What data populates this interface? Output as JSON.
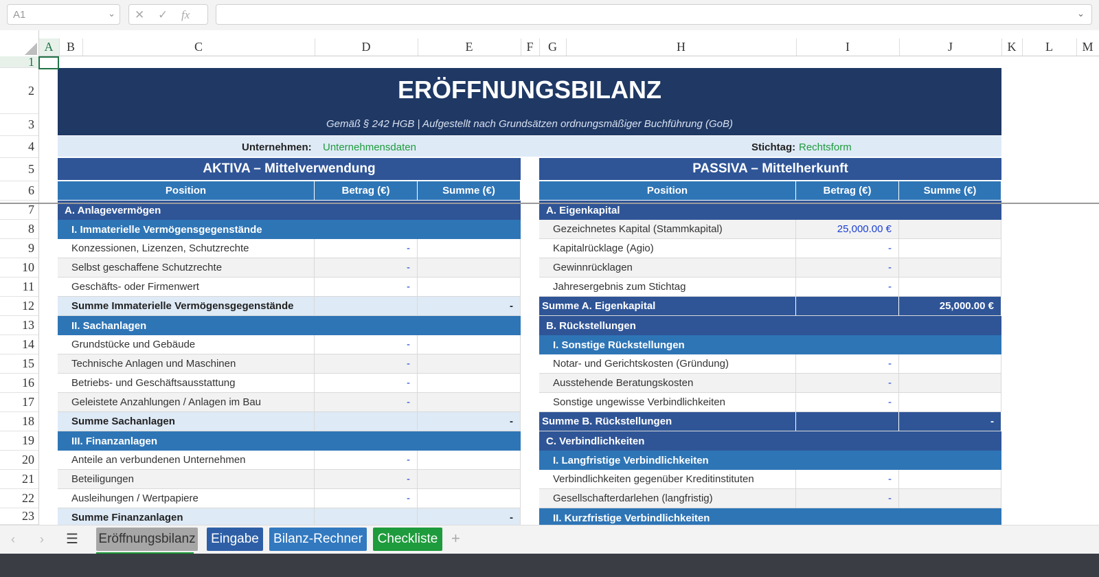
{
  "formula_bar": {
    "cell_ref": "A1",
    "cancel": "✕",
    "confirm": "✓",
    "fx": "fx",
    "formula": ""
  },
  "columns": [
    "A",
    "B",
    "C",
    "D",
    "E",
    "F",
    "G",
    "H",
    "I",
    "J",
    "K",
    "L",
    "M"
  ],
  "rows": [
    "1",
    "2",
    "3",
    "4",
    "5",
    "6",
    "7",
    "8",
    "9",
    "10",
    "11",
    "12",
    "13",
    "14",
    "15",
    "16",
    "17",
    "18",
    "19",
    "20",
    "21",
    "22",
    "23"
  ],
  "header": {
    "title": "ERÖFFNUNGSBILANZ",
    "subtitle": "Gemäß § 242 HGB  |  Aufgestellt nach Grundsätzen ordnungsmäßiger Buchführung (GoB)",
    "company_label": "Unternehmen:",
    "company_value": "Unternehmensdaten",
    "date_label": "Stichtag:",
    "date_value": "Rechtsform"
  },
  "aktiva": {
    "title": "AKTIVA  –  Mittelverwendung",
    "col_position": "Position",
    "col_betrag": "Betrag (€)",
    "col_summe": "Summe (€)",
    "rows": [
      {
        "type": "sec",
        "label": "A.  Anlagevermögen",
        "betrag": "",
        "summe": ""
      },
      {
        "type": "sub",
        "label": "I.  Immaterielle Vermögensgegenstände",
        "betrag": "",
        "summe": ""
      },
      {
        "type": "item",
        "label": "Konzessionen, Lizenzen, Schutzrechte",
        "betrag": "-",
        "summe": ""
      },
      {
        "type": "item alt",
        "label": "Selbst geschaffene Schutzrechte",
        "betrag": "-",
        "summe": ""
      },
      {
        "type": "item",
        "label": "Geschäfts- oder Firmenwert",
        "betrag": "-",
        "summe": ""
      },
      {
        "type": "sum",
        "label": "Summe Immaterielle Vermögensgegenstände",
        "betrag": "",
        "summe": "-"
      },
      {
        "type": "sub",
        "label": "II.  Sachanlagen",
        "betrag": "",
        "summe": ""
      },
      {
        "type": "item",
        "label": "Grundstücke und Gebäude",
        "betrag": "-",
        "summe": ""
      },
      {
        "type": "item alt",
        "label": "Technische Anlagen und Maschinen",
        "betrag": "-",
        "summe": ""
      },
      {
        "type": "item",
        "label": "Betriebs- und Geschäftsausstattung",
        "betrag": "-",
        "summe": ""
      },
      {
        "type": "item alt",
        "label": "Geleistete Anzahlungen / Anlagen im Bau",
        "betrag": "-",
        "summe": ""
      },
      {
        "type": "sum",
        "label": "Summe Sachanlagen",
        "betrag": "",
        "summe": "-"
      },
      {
        "type": "sub",
        "label": "III.  Finanzanlagen",
        "betrag": "",
        "summe": ""
      },
      {
        "type": "item",
        "label": "Anteile an verbundenen Unternehmen",
        "betrag": "-",
        "summe": ""
      },
      {
        "type": "item alt",
        "label": "Beteiligungen",
        "betrag": "-",
        "summe": ""
      },
      {
        "type": "item",
        "label": "Ausleihungen / Wertpapiere",
        "betrag": "-",
        "summe": ""
      },
      {
        "type": "sum",
        "label": "Summe Finanzanlagen",
        "betrag": "",
        "summe": "-"
      }
    ]
  },
  "passiva": {
    "title": "PASSIVA  –  Mittelherkunft",
    "col_position": "Position",
    "col_betrag": "Betrag (€)",
    "col_summe": "Summe (€)",
    "rows": [
      {
        "type": "sec",
        "label": "A.  Eigenkapital",
        "betrag": "",
        "summe": ""
      },
      {
        "type": "item alt",
        "label": "Gezeichnetes Kapital (Stammkapital)",
        "betrag": "25,000.00 €",
        "summe": ""
      },
      {
        "type": "item",
        "label": "Kapitalrücklage (Agio)",
        "betrag": "-",
        "summe": ""
      },
      {
        "type": "item alt",
        "label": "Gewinnrücklagen",
        "betrag": "-",
        "summe": ""
      },
      {
        "type": "item",
        "label": "Jahresergebnis zum Stichtag",
        "betrag": "-",
        "summe": ""
      },
      {
        "type": "sumd",
        "label": "Summe A.  Eigenkapital",
        "betrag": "",
        "summe": "25,000.00 €"
      },
      {
        "type": "sec",
        "label": "B.  Rückstellungen",
        "betrag": "",
        "summe": ""
      },
      {
        "type": "sub",
        "label": "I.  Sonstige Rückstellungen",
        "betrag": "",
        "summe": ""
      },
      {
        "type": "item",
        "label": "Notar- und Gerichtskosten (Gründung)",
        "betrag": "-",
        "summe": ""
      },
      {
        "type": "item alt",
        "label": "Ausstehende Beratungskosten",
        "betrag": "-",
        "summe": ""
      },
      {
        "type": "item",
        "label": "Sonstige ungewisse Verbindlichkeiten",
        "betrag": "-",
        "summe": ""
      },
      {
        "type": "sumd",
        "label": "Summe B.  Rückstellungen",
        "betrag": "",
        "summe": "-"
      },
      {
        "type": "sec",
        "label": "C.  Verbindlichkeiten",
        "betrag": "",
        "summe": ""
      },
      {
        "type": "sub",
        "label": "I.  Langfristige Verbindlichkeiten",
        "betrag": "",
        "summe": ""
      },
      {
        "type": "item",
        "label": "Verbindlichkeiten gegenüber Kreditinstituten",
        "betrag": "-",
        "summe": ""
      },
      {
        "type": "item alt",
        "label": "Gesellschafterdarlehen (langfristig)",
        "betrag": "-",
        "summe": ""
      },
      {
        "type": "sub",
        "label": "II.  Kurzfristige Verbindlichkeiten",
        "betrag": "",
        "summe": ""
      }
    ]
  },
  "tabs": [
    {
      "label": "Eröffnungsbilanz",
      "style": "active"
    },
    {
      "label": "Eingabe",
      "style": "b1"
    },
    {
      "label": "Bilanz-Rechner",
      "style": "b2"
    },
    {
      "label": "Checkliste",
      "style": "g"
    }
  ],
  "tab_nav": {
    "prev": "‹",
    "next": "›",
    "menu": "☰",
    "add": "+"
  }
}
